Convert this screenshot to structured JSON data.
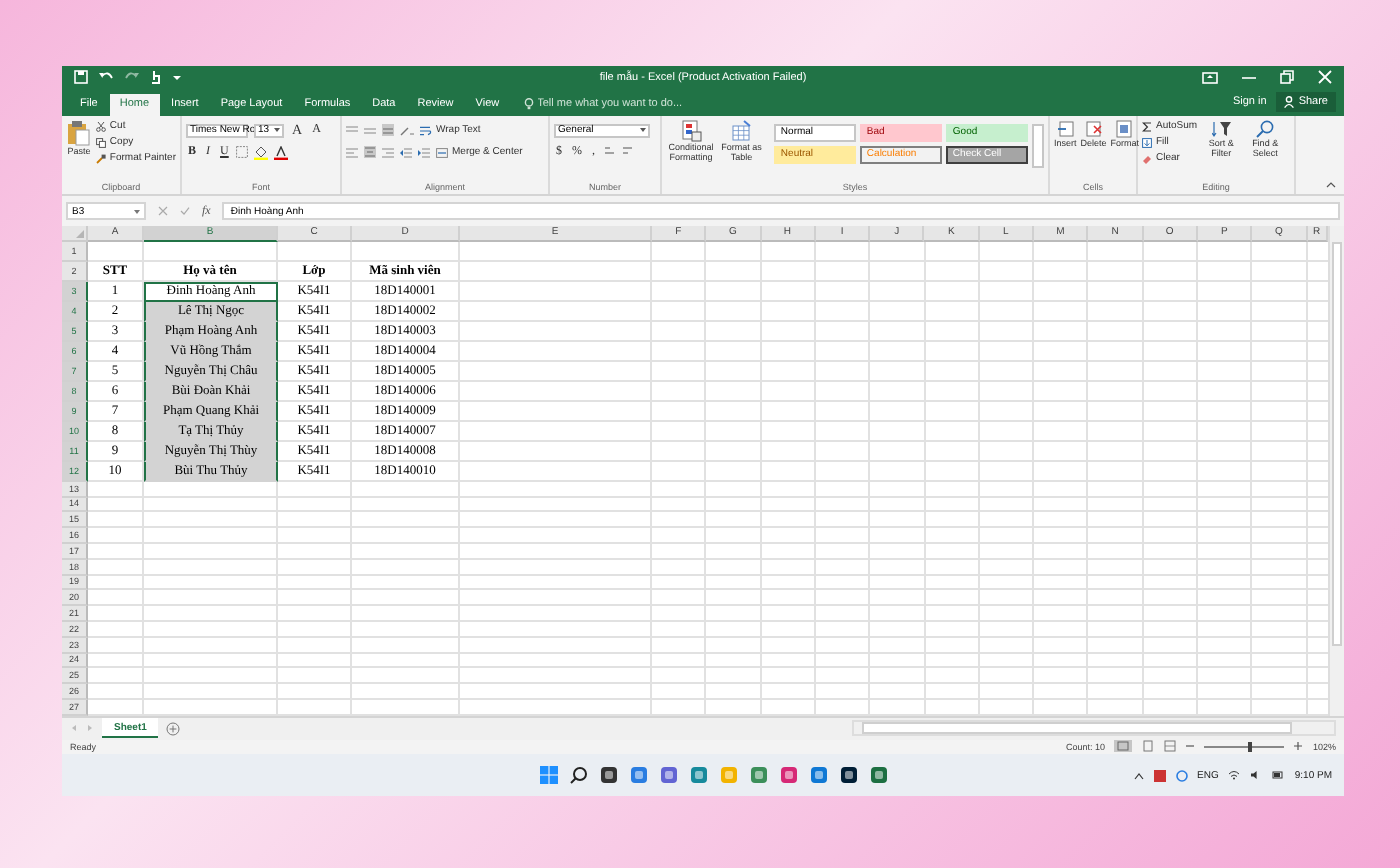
{
  "title_bar": {
    "title": "file mẫu - Excel (Product Activation Failed)"
  },
  "ribbon_tabs": [
    {
      "label": "File",
      "selected": false
    },
    {
      "label": "Home",
      "selected": true
    },
    {
      "label": "Insert",
      "selected": false
    },
    {
      "label": "Page Layout",
      "selected": false
    },
    {
      "label": "Formulas",
      "selected": false
    },
    {
      "label": "Data",
      "selected": false
    },
    {
      "label": "Review",
      "selected": false
    },
    {
      "label": "View",
      "selected": false
    }
  ],
  "tell_me": {
    "placeholder": "Tell me what you want to do..."
  },
  "account": {
    "sign_in": "Sign in",
    "share": "Share"
  },
  "clipboard": {
    "paste": "Paste",
    "cut": "Cut",
    "copy": "Copy",
    "format_painter": "Format Painter",
    "label": "Clipboard"
  },
  "font": {
    "name": "Times New Ro",
    "size": "13",
    "grow": "A",
    "shrink": "A",
    "bold": "B",
    "italic": "I",
    "underline": "U",
    "label": "Font"
  },
  "alignment": {
    "wrap_text": "Wrap Text",
    "merge": "Merge & Center",
    "label": "Alignment"
  },
  "number": {
    "format": "General",
    "currency": "$",
    "percent": "%",
    "comma": ",",
    "label": "Number"
  },
  "styles": {
    "conditional": "Conditional Formatting",
    "format_table": "Format as Table",
    "label": "Styles",
    "gallery": [
      {
        "label": "Normal",
        "kind": "normal"
      },
      {
        "label": "Bad",
        "kind": "bad"
      },
      {
        "label": "Good",
        "kind": "good"
      },
      {
        "label": "Neutral",
        "kind": "neutral"
      },
      {
        "label": "Calculation",
        "kind": "calculation"
      },
      {
        "label": "Check Cell",
        "kind": "check"
      }
    ]
  },
  "cells_group": {
    "insert": "Insert",
    "delete": "Delete",
    "format": "Format",
    "label": "Cells"
  },
  "editing": {
    "autosum": "AutoSum",
    "fill": "Fill",
    "clear": "Clear",
    "sort": "Sort & Filter",
    "find": "Find & Select",
    "label": "Editing"
  },
  "formula_bar": {
    "name_box": "B3",
    "fx": "fx",
    "value": "Đinh Hoàng Anh"
  },
  "columns": [
    {
      "label": "A",
      "selected": false
    },
    {
      "label": "B",
      "selected": true
    },
    {
      "label": "C",
      "selected": false
    },
    {
      "label": "D",
      "selected": false
    },
    {
      "label": "E",
      "selected": false
    },
    {
      "label": "F",
      "selected": false
    },
    {
      "label": "G",
      "selected": false
    },
    {
      "label": "H",
      "selected": false
    },
    {
      "label": "I",
      "selected": false
    },
    {
      "label": "J",
      "selected": false
    },
    {
      "label": "K",
      "selected": false
    },
    {
      "label": "L",
      "selected": false
    },
    {
      "label": "M",
      "selected": false
    },
    {
      "label": "N",
      "selected": false
    },
    {
      "label": "O",
      "selected": false
    },
    {
      "label": "P",
      "selected": false
    },
    {
      "label": "Q",
      "selected": false
    },
    {
      "label": "R",
      "selected": false
    }
  ],
  "rows": [
    {
      "number": "1",
      "kind": "blank",
      "selected": false,
      "active": false,
      "cells": []
    },
    {
      "number": "2",
      "kind": "header",
      "selected": false,
      "active": false,
      "cells": [
        "STT",
        "Họ và tên",
        "Lớp",
        "Mã sinh viên"
      ]
    },
    {
      "number": "3",
      "kind": "data",
      "selected": true,
      "active": true,
      "cells": [
        "1",
        "Đinh Hoàng Anh",
        "K54I1",
        "18D140001"
      ]
    },
    {
      "number": "4",
      "kind": "data",
      "selected": true,
      "active": false,
      "cells": [
        "2",
        "Lê Thị Ngọc",
        "K54I1",
        "18D140002"
      ]
    },
    {
      "number": "5",
      "kind": "data",
      "selected": true,
      "active": false,
      "cells": [
        "3",
        "Phạm Hoàng Anh",
        "K54I1",
        "18D140003"
      ]
    },
    {
      "number": "6",
      "kind": "data",
      "selected": true,
      "active": false,
      "cells": [
        "4",
        "Vũ Hồng Thắm",
        "K54I1",
        "18D140004"
      ]
    },
    {
      "number": "7",
      "kind": "data",
      "selected": true,
      "active": false,
      "cells": [
        "5",
        "Nguyễn Thị Châu",
        "K54I1",
        "18D140005"
      ]
    },
    {
      "number": "8",
      "kind": "data",
      "selected": true,
      "active": false,
      "cells": [
        "6",
        "Bùi Đoàn Khải",
        "K54I1",
        "18D140006"
      ]
    },
    {
      "number": "9",
      "kind": "data",
      "selected": true,
      "active": false,
      "cells": [
        "7",
        "Phạm Quang Khải",
        "K54I1",
        "18D140009"
      ]
    },
    {
      "number": "10",
      "kind": "data",
      "selected": true,
      "active": false,
      "cells": [
        "8",
        "Tạ Thị Thủy",
        "K54I1",
        "18D140007"
      ]
    },
    {
      "number": "11",
      "kind": "data",
      "selected": true,
      "active": false,
      "cells": [
        "9",
        "Nguyễn Thị Thùy",
        "K54I1",
        "18D140008"
      ]
    },
    {
      "number": "12",
      "kind": "data",
      "selected": true,
      "active": false,
      "cells": [
        "10",
        "Bùi Thu Thủy",
        "K54I1",
        "18D140010"
      ]
    },
    {
      "number": "13",
      "kind": "blank",
      "selected": false,
      "active": false,
      "cells": []
    },
    {
      "number": "14",
      "kind": "blank",
      "selected": false,
      "active": false,
      "cells": []
    },
    {
      "number": "15",
      "kind": "blank",
      "selected": false,
      "active": false,
      "cells": []
    },
    {
      "number": "16",
      "kind": "blank",
      "selected": false,
      "active": false,
      "cells": []
    },
    {
      "number": "17",
      "kind": "blank",
      "selected": false,
      "active": false,
      "cells": []
    },
    {
      "number": "18",
      "kind": "blank",
      "selected": false,
      "active": false,
      "cells": []
    },
    {
      "number": "19",
      "kind": "blank",
      "selected": false,
      "active": false,
      "cells": []
    },
    {
      "number": "20",
      "kind": "blank",
      "selected": false,
      "active": false,
      "cells": []
    },
    {
      "number": "21",
      "kind": "blank",
      "selected": false,
      "active": false,
      "cells": []
    },
    {
      "number": "22",
      "kind": "blank",
      "selected": false,
      "active": false,
      "cells": []
    },
    {
      "number": "23",
      "kind": "blank",
      "selected": false,
      "active": false,
      "cells": []
    },
    {
      "number": "24",
      "kind": "blank",
      "selected": false,
      "active": false,
      "cells": []
    },
    {
      "number": "25",
      "kind": "blank",
      "selected": false,
      "active": false,
      "cells": []
    },
    {
      "number": "26",
      "kind": "blank",
      "selected": false,
      "active": false,
      "cells": []
    },
    {
      "number": "27",
      "kind": "blank",
      "selected": false,
      "active": false,
      "cells": []
    }
  ],
  "sheet_tabs": [
    {
      "label": "Sheet1",
      "selected": true
    }
  ],
  "status_bar": {
    "ready": "Ready",
    "count": "Count: 10",
    "zoom": "102%",
    "zoom_level": {
      "level": 0.55
    }
  },
  "taskbar": {
    "language": "ENG",
    "time": "9:10 PM"
  }
}
